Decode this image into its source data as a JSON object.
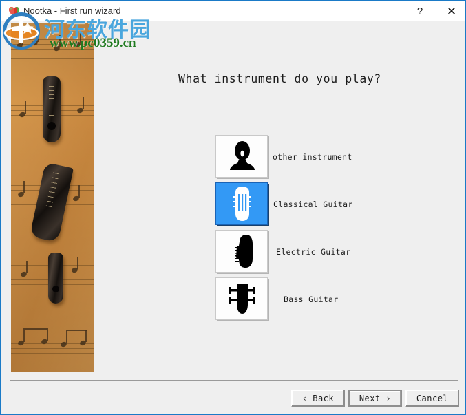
{
  "window": {
    "title": "Nootka - First run wizard",
    "app_icon": "heart-icon",
    "accent_color": "#1a7ac7",
    "titlebar_bg": "#ffffff",
    "body_bg": "#efefef"
  },
  "titlebar_buttons": {
    "help_label": "?",
    "close_label": "✕"
  },
  "watermark": {
    "site_name": "河东软件园",
    "url": "www.pc0359.cn",
    "logo_icon": "pc-online-logo-icon"
  },
  "side_panel": {
    "image_alt": "guitar-pins-on-sheet-music-photo"
  },
  "main": {
    "question": "What instrument do you play?",
    "instruments": [
      {
        "label": "other instrument",
        "icon": "person-silhouette-icon",
        "selected": false,
        "label_indent": 83
      },
      {
        "label": "Classical Guitar",
        "icon": "classical-guitar-headstock-icon",
        "selected": true,
        "label_indent": 84
      },
      {
        "label": "Electric Guitar",
        "icon": "electric-guitar-headstock-icon",
        "selected": false,
        "label_indent": 88
      },
      {
        "label": "Bass Guitar",
        "icon": "bass-guitar-headstock-icon",
        "selected": false,
        "label_indent": 99
      }
    ],
    "selected_color": "#3399f5"
  },
  "footer": {
    "back_label": "‹ Back",
    "next_label": "Next ›",
    "cancel_label": "Cancel"
  }
}
